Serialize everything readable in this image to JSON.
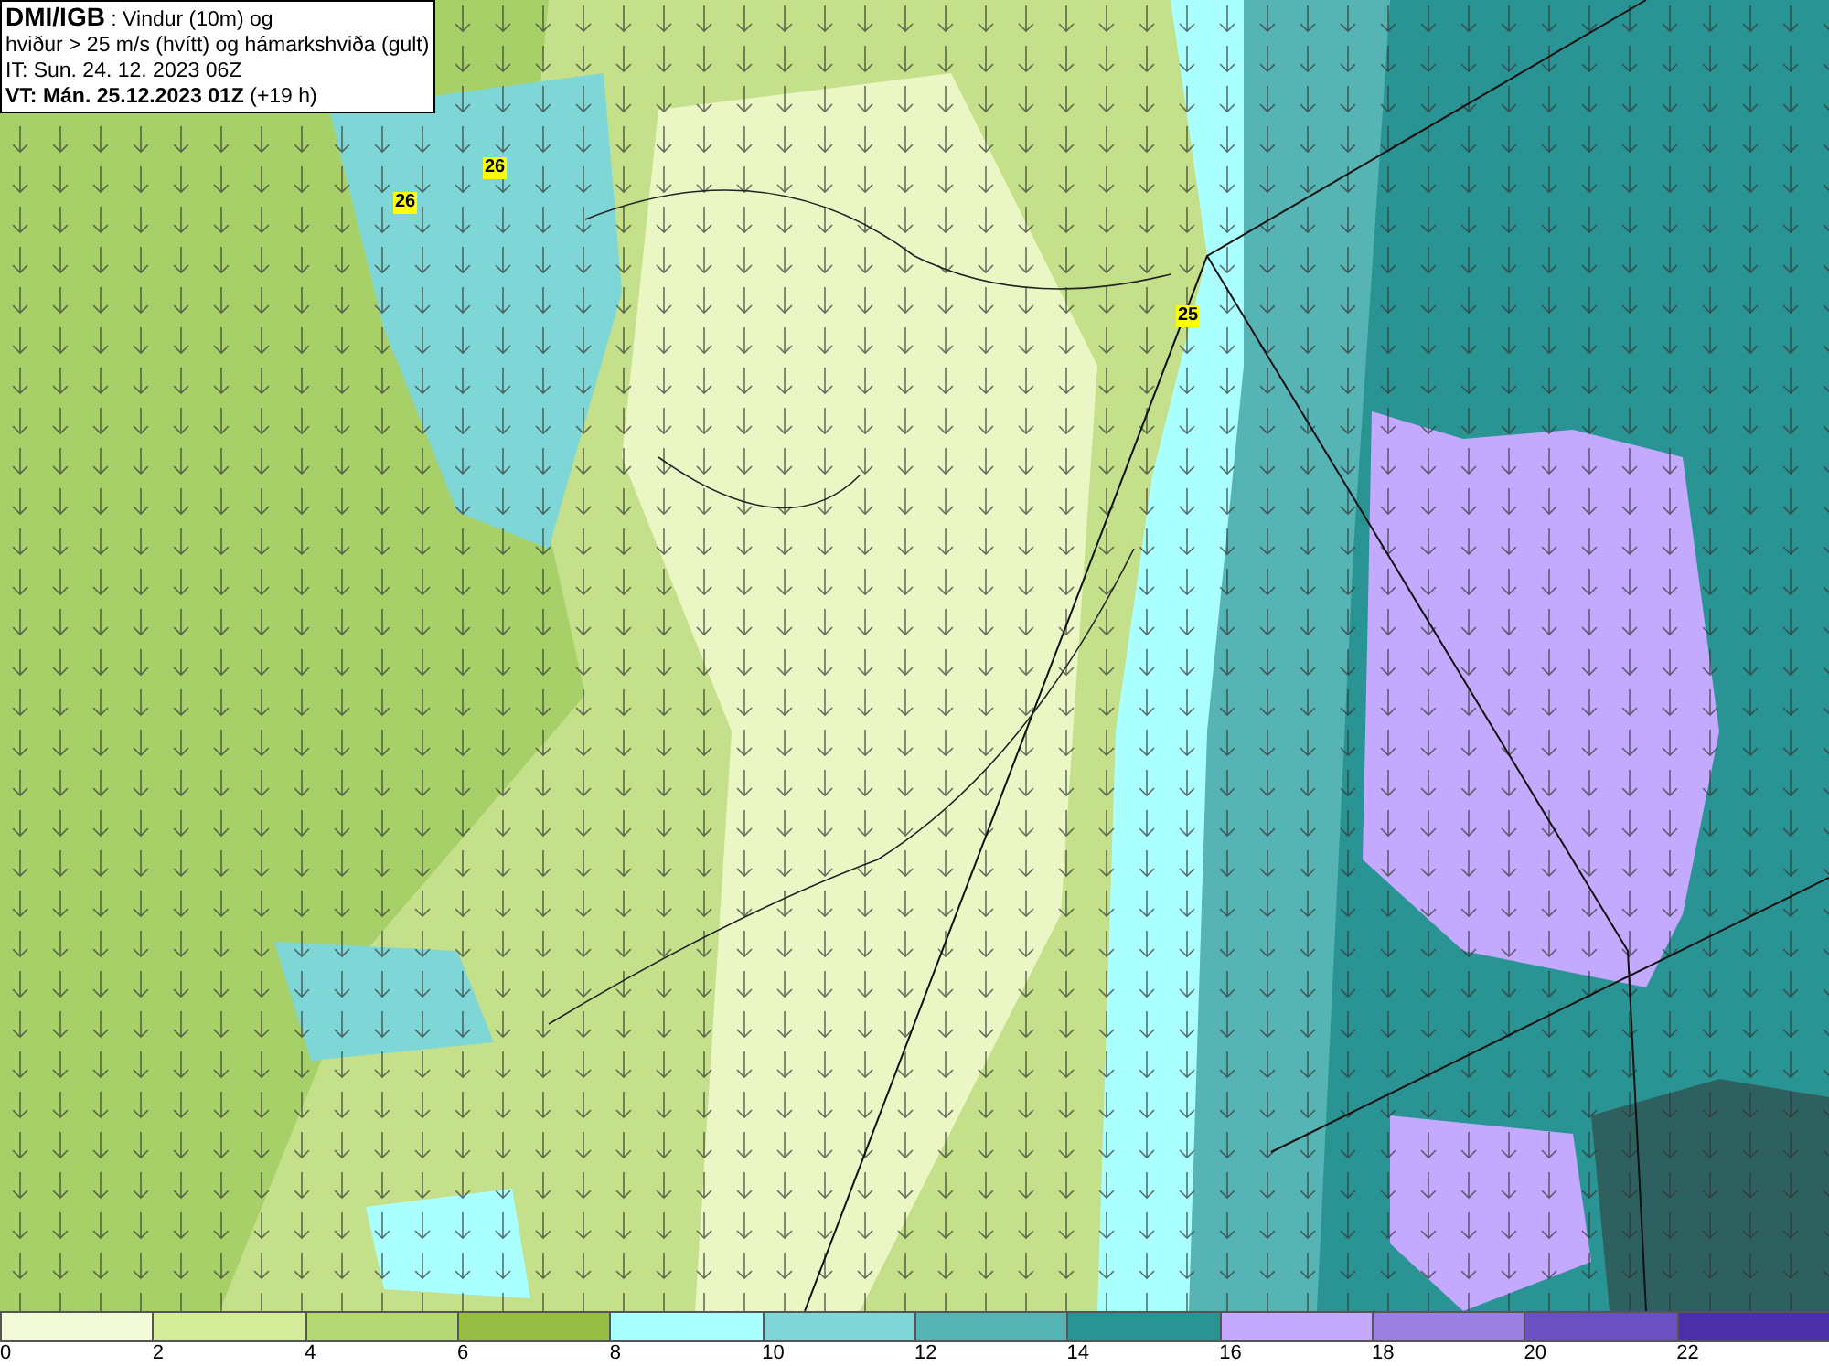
{
  "header": {
    "source": "DMI/IGB",
    "title": ": Vindur (10m) og",
    "subtitle": "hviður > 25 m/s (hvítt) og hámarkshviða (gult)",
    "initial_time": "IT: Sun. 24. 12. 2023 06Z",
    "valid_time": "VT: Mán. 25.12.2023 01Z",
    "lead": "(+19 h)"
  },
  "map": {
    "gust_labels": [
      {
        "text": "26"
      },
      {
        "text": "26"
      },
      {
        "text": "25"
      }
    ]
  },
  "legend": [
    {
      "color": "#f3fad8",
      "label": "0"
    },
    {
      "color": "#d4ec9a",
      "label": "2"
    },
    {
      "color": "#b4d874",
      "label": "4"
    },
    {
      "color": "#96be44",
      "label": "6"
    },
    {
      "color": "#aaffff",
      "label": "8"
    },
    {
      "color": "#7fd6d6",
      "label": "10"
    },
    {
      "color": "#56b4b4",
      "label": "12"
    },
    {
      "color": "#2a9494",
      "label": "14"
    },
    {
      "color": "#c4aaff",
      "label": "16"
    },
    {
      "color": "#9a80e0",
      "label": "18"
    },
    {
      "color": "#6a50c0",
      "label": "20"
    },
    {
      "color": "#4a30a8",
      "label": "22"
    }
  ]
}
